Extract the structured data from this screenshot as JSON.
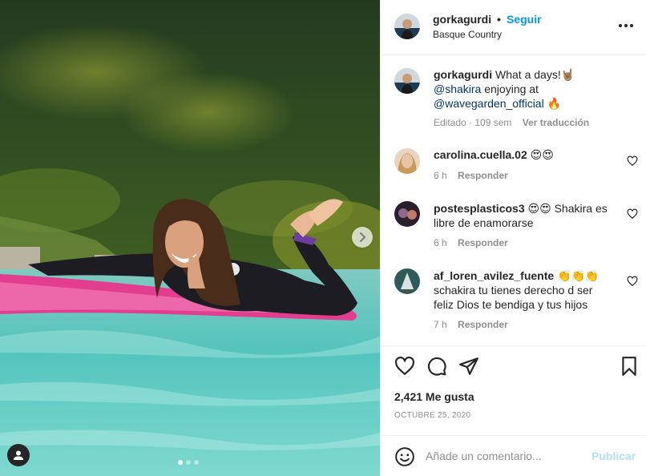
{
  "post": {
    "author": "gorkagurdi",
    "follow_separator": "•",
    "follow_label": "Seguir",
    "location": "Basque Country",
    "more_icon": "more-horizontal-icon"
  },
  "caption": {
    "author": "gorkagurdi",
    "text_1": "What a days!🤘🏽",
    "mention_1": "@shakira",
    "text_2": "enjoying at",
    "mention_2": "@wavegarden_official",
    "text_3": "🔥",
    "edited": "Editado",
    "age": "109 sem",
    "translate": "Ver traducción"
  },
  "comments": [
    {
      "user": "carolina.cuella.02",
      "text": "😍😍",
      "age": "6 h",
      "reply": "Responder"
    },
    {
      "user": "postesplasticos3",
      "text": "😍😍 Shakira es libre de enamorarse",
      "age": "6 h",
      "reply": "Responder"
    },
    {
      "user": "af_loren_avilez_fuente",
      "text": "👏👏👏 schakira tu tienes derecho d ser feliz Dios te bendiga y tus hijos",
      "age": "7 h",
      "reply": "Responder"
    }
  ],
  "stats": {
    "likes": "2,421 Me gusta",
    "date": "OCTUBRE 25, 2020"
  },
  "composer": {
    "placeholder": "Añade un comentario...",
    "publish": "Publicar"
  },
  "carousel": {
    "slides": 3,
    "active": 1
  },
  "colors": {
    "link_blue": "#0095f6",
    "muted": "#8e8e8e",
    "mention": "#00376b",
    "text": "#262626"
  }
}
